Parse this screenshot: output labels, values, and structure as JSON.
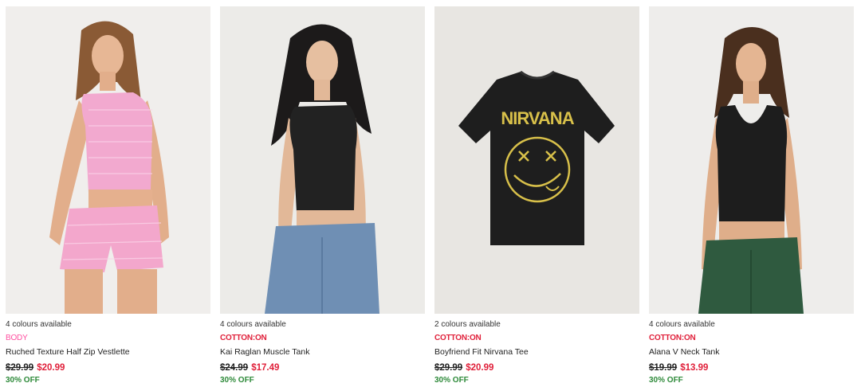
{
  "products": [
    {
      "colours": "4 colours available",
      "brand": "BODY",
      "brand_color": "#ff4fa0",
      "name": "Ruched Texture Half Zip Vestlette",
      "was_price": "$29.99",
      "now_price": "$20.99",
      "discount": "30% OFF",
      "image": "model-pink-gingham-set"
    },
    {
      "colours": "4 colours available",
      "brand": "COTTON:ON",
      "brand_color": "#e0203a",
      "name": "Kai Raglan Muscle Tank",
      "was_price": "$24.99",
      "now_price": "$17.49",
      "discount": "30% OFF",
      "image": "model-black-tank-jeans"
    },
    {
      "colours": "2 colours available",
      "brand": "COTTON:ON",
      "brand_color": "#e0203a",
      "name": "Boyfriend Fit Nirvana Tee",
      "was_price": "$29.99",
      "now_price": "$20.99",
      "discount": "30% OFF",
      "image": "nirvana-tee-flatlay",
      "tee_text": "NIRVANA"
    },
    {
      "colours": "4 colours available",
      "brand": "COTTON:ON",
      "brand_color": "#e0203a",
      "name": "Alana V Neck Tank",
      "was_price": "$19.99",
      "now_price": "$13.99",
      "discount": "30% OFF",
      "image": "model-black-vneck-green-pants"
    }
  ]
}
